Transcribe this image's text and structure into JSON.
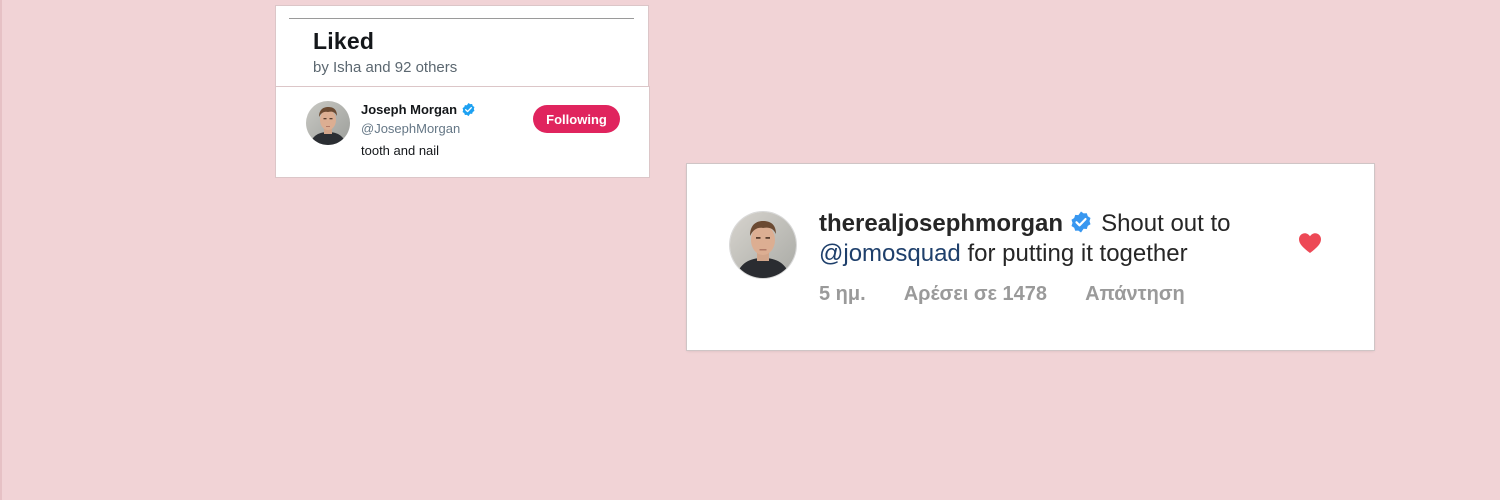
{
  "liked_panel": {
    "title": "Liked",
    "subtitle": "by Isha and 92 others"
  },
  "user_row": {
    "name": "Joseph Morgan",
    "handle": "@JosephMorgan",
    "bio": "tooth and nail",
    "follow_label": "Following",
    "verified": true
  },
  "comment": {
    "username": "therealjosephmorgan",
    "text_before": "Shout out to",
    "mention": "@jomosquad",
    "text_after": "for putting it together",
    "time": "5 ημ.",
    "likes": "Αρέσει σε 1478",
    "reply": "Απάντηση",
    "verified": true,
    "liked": true
  },
  "colors": {
    "background": "#f1d3d6",
    "follow_button": "#e0245e",
    "verified_blue": "#1da1f2",
    "heart_red": "#ed4956",
    "mention": "#1e3f6b"
  }
}
